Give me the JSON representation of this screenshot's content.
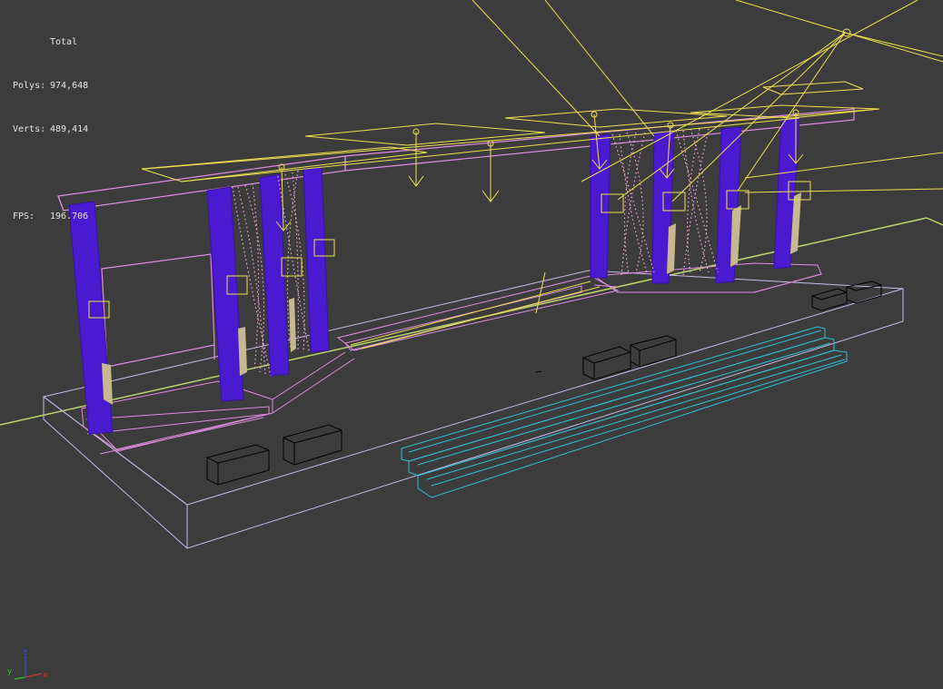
{
  "stats": {
    "title": "Total",
    "polys_label": "Polys:",
    "polys_value": "974,648",
    "verts_label": "Verts:",
    "verts_value": "489,414",
    "fps_label": "FPS:",
    "fps_value": "196.706"
  },
  "axis_gizmo": {
    "x_label": "x",
    "y_label": "y",
    "z_label": "z",
    "colors": {
      "x": "#d03030",
      "y": "#30c030",
      "z": "#3050e0"
    }
  },
  "colors": {
    "background": "#3c3c3c",
    "ground_line": "#b8d46a",
    "frame_pink": "#e08ce0",
    "columns_purple": "#4a1ad0",
    "columns_outline": "#3a10a8",
    "lights_yellow": "#f0e050",
    "curtain_pink": "#f2a8d8",
    "stage_lavender": "#c8b8e8",
    "steps_cyan": "#30c0d8",
    "boxes_black": "#000000",
    "tan_fill": "#c8b890"
  }
}
